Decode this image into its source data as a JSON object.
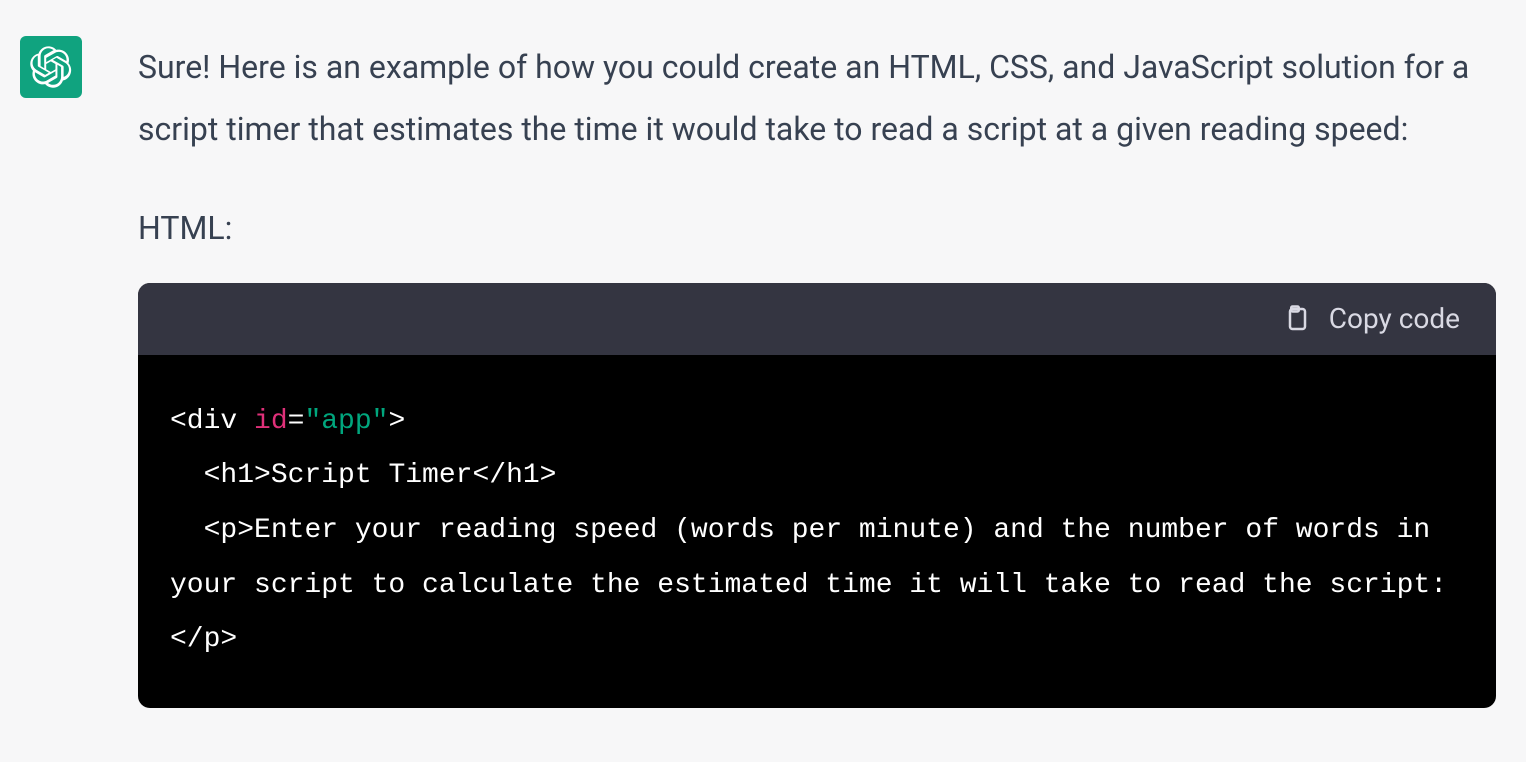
{
  "message": {
    "paragraph": "Sure! Here is an example of how you could create an HTML, CSS, and JavaScript solution for a script timer that estimates the time it would take to read a script at a given reading speed:",
    "label": "HTML:"
  },
  "code": {
    "copy_label": "Copy code",
    "tokens": {
      "tag_div_open_start": "<div ",
      "attr_id": "id",
      "eq": "=",
      "attr_val_app": "\"app\"",
      "tag_close": ">",
      "nl": "\n",
      "indent1": "  ",
      "h1_open": "<h1>",
      "h1_text": "Script Timer",
      "h1_close": "</h1>",
      "p_open": "<p>",
      "p_text": "Enter your reading speed (words per minute) and the number of words in your script to calculate the estimated time it will take to read the script:",
      "p_close": "</p>"
    }
  }
}
